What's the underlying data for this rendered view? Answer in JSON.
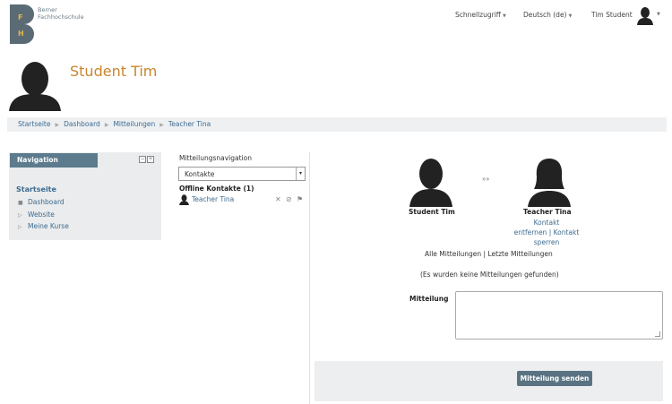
{
  "brand": {
    "logo_line1": "Berner",
    "logo_line2": "Fachhochschule",
    "logo_letters": [
      "F",
      "H"
    ],
    "colors": {
      "logo_bg": "#5a6b76",
      "logo_letter": "#e9b34a",
      "title": "#c8862c",
      "link": "#3d6b90",
      "nav_header": "#5c7b8d",
      "button": "#5a7383"
    }
  },
  "topnav": {
    "quick_access": "Schnellzugriff",
    "language": "Deutsch (de)",
    "user": "Tim Student"
  },
  "profile": {
    "name": "Student Tim"
  },
  "breadcrumb": [
    "Startseite",
    "Dashboard",
    "Mitteilungen",
    "Teacher Tina"
  ],
  "navigation": {
    "title": "Navigation",
    "home": "Startseite",
    "items": [
      {
        "label": "Dashboard",
        "bullet": "■"
      },
      {
        "label": "Website",
        "bullet": "▷"
      },
      {
        "label": "Meine Kurse",
        "bullet": "▷"
      }
    ]
  },
  "message_nav": {
    "title": "Mitteilungsnavigation",
    "selected": "Kontakte",
    "offline_header": "Offline Kontakte (1)",
    "contacts": [
      {
        "name": "Teacher Tina"
      }
    ]
  },
  "conversation": {
    "user_a": "Student Tim",
    "user_b": "Teacher Tina",
    "contact_action_line1": "Kontakt",
    "contact_action_line2": "entfernen | Kontakt",
    "contact_action_line3": "sperren",
    "all_messages": "Alle Mitteilungen",
    "separator": "|",
    "recent_messages": "Letzte Mitteilungen",
    "empty": "(Es wurden keine Mitteilungen gefunden)",
    "message_label": "Mitteilung",
    "send_button": "Mitteilung senden"
  }
}
